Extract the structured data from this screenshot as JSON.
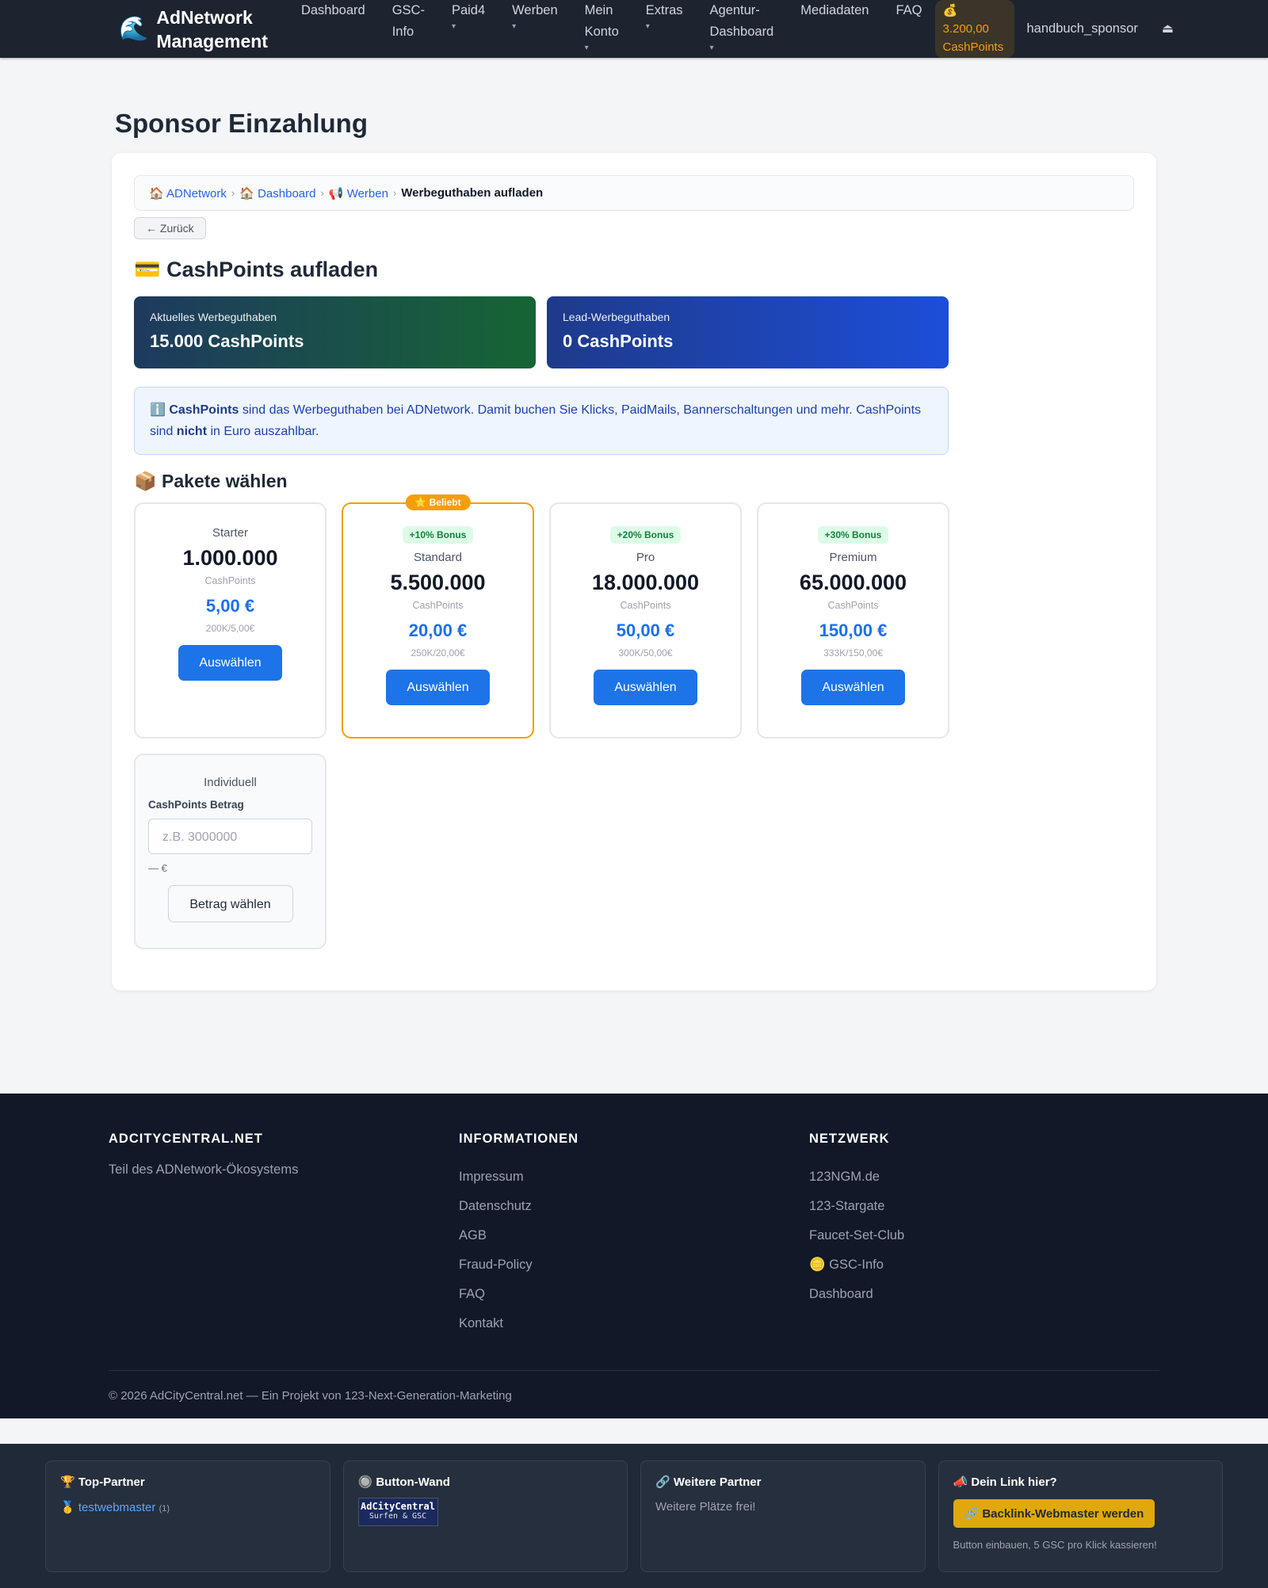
{
  "nav": {
    "brand_icon": "🌊",
    "brand_line1": "AdNetwork",
    "brand_line2": "Management",
    "items": [
      {
        "label_line1": "Dashboard",
        "label_line2": "",
        "caret": ""
      },
      {
        "label_line1": "GSC-",
        "label_line2": "Info",
        "caret": ""
      },
      {
        "label_line1": "Paid4",
        "label_line2": "",
        "caret": "▾"
      },
      {
        "label_line1": "Werben",
        "label_line2": "",
        "caret": "▾"
      },
      {
        "label_line1": "Mein",
        "label_line2": "Konto",
        "caret": "▾"
      },
      {
        "label_line1": "Extras",
        "label_line2": "",
        "caret": "▾"
      },
      {
        "label_line1": "Agentur-",
        "label_line2": "Dashboard",
        "caret": "▾"
      },
      {
        "label_line1": "Mediadaten",
        "label_line2": "",
        "caret": ""
      },
      {
        "label_line1": "FAQ",
        "label_line2": "",
        "caret": ""
      }
    ],
    "cashpoints_icon": "💰",
    "cashpoints_value": "3.200,00",
    "cashpoints_unit": "CashPoints",
    "username": "handbuch_sponsor",
    "logout_icon": "⏏"
  },
  "page": {
    "title": "Sponsor Einzahlung",
    "breadcrumb": [
      {
        "icon": "🏠",
        "label": "ADNetwork"
      },
      {
        "icon": "🏠",
        "label": "Dashboard"
      },
      {
        "icon": "📢",
        "label": "Werben"
      }
    ],
    "breadcrumb_sep": "›",
    "breadcrumb_current": "Werbeguthaben aufladen",
    "back_label": "← Zurück",
    "section_title": "💳 CashPoints aufladen",
    "balances": [
      {
        "label": "Aktuelles Werbeguthaben",
        "value": "15.000 CashPoints"
      },
      {
        "label": "Lead-Werbeguthaben",
        "value": "0 CashPoints"
      }
    ],
    "info": {
      "icon": "ℹ️",
      "bold1": "CashPoints",
      "text1": " sind das Werbeguthaben bei ADNetwork. Damit buchen Sie Klicks, PaidMails, Bannerschaltungen und mehr. CashPoints sind ",
      "bold2": "nicht",
      "text2": " in Euro auszahlbar."
    },
    "packages_title": "📦 Pakete wählen",
    "packages": [
      {
        "ribbon": "",
        "bonus": "",
        "name": "Starter",
        "amount": "1.000.000",
        "unit": "CashPoints",
        "price": "5,00 €",
        "ratio": "200K/5,00€",
        "button": "Auswählen"
      },
      {
        "ribbon": "⭐ Beliebt",
        "bonus": "+10% Bonus",
        "name": "Standard",
        "amount": "5.500.000",
        "unit": "CashPoints",
        "price": "20,00 €",
        "ratio": "250K/20,00€",
        "button": "Auswählen"
      },
      {
        "ribbon": "",
        "bonus": "+20% Bonus",
        "name": "Pro",
        "amount": "18.000.000",
        "unit": "CashPoints",
        "price": "50,00 €",
        "ratio": "300K/50,00€",
        "button": "Auswählen"
      },
      {
        "ribbon": "",
        "bonus": "+30% Bonus",
        "name": "Premium",
        "amount": "65.000.000",
        "unit": "CashPoints",
        "price": "150,00 €",
        "ratio": "333K/150,00€",
        "button": "Auswählen"
      }
    ],
    "custom": {
      "title": "Individuell",
      "label": "CashPoints Betrag",
      "placeholder": "z.B. 3000000",
      "eur": "— €",
      "button": "Betrag wählen"
    }
  },
  "footer": {
    "col1_title": "ADCITYCENTRAL.NET",
    "col1_text": "Teil des ADNetwork-Ökosystems",
    "col2_title": "INFORMATIONEN",
    "col2_links": [
      "Impressum",
      "Datenschutz",
      "AGB",
      "Fraud-Policy",
      "FAQ",
      "Kontakt"
    ],
    "col3_title": "NETZWERK",
    "col3_links": [
      "123NGM.de",
      "123-Stargate",
      "Faucet-Set-Club",
      "🪙 GSC-Info",
      "Dashboard"
    ],
    "copyright": "© 2026 AdCityCentral.net — Ein Projekt von 123-Next-Generation-Marketing"
  },
  "partners": {
    "top_title": "🏆 Top-Partner",
    "top_medal": "🥇",
    "top_name": "testwebmaster",
    "top_count": "(1)",
    "wall_title": "🔘 Button-Wand",
    "wall_btn_line1": "AdCityCentral",
    "wall_btn_line2": "Surfen & GSC",
    "more_title": "🔗 Weitere Partner",
    "more_text": "Weitere Plätze frei!",
    "link_title": "📣 Dein Link hier?",
    "link_button": "🔗 Backlink-Webmaster werden",
    "link_small": "Button einbauen, 5 GSC pro Klick kassieren!"
  }
}
